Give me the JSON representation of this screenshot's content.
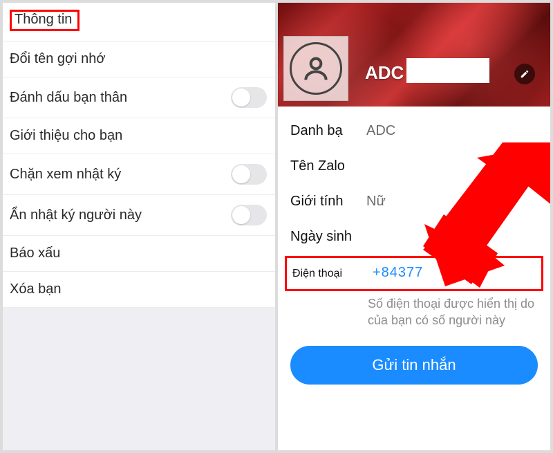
{
  "left": {
    "title": "Thông tin",
    "items": [
      {
        "label": "Đổi tên gợi nhớ",
        "toggle": false
      },
      {
        "label": "Đánh dấu bạn thân",
        "toggle": true
      },
      {
        "label": "Giới thiệu cho bạn",
        "toggle": false
      },
      {
        "label": "Chặn xem nhật ký",
        "toggle": true
      },
      {
        "label": "Ẩn nhật ký người này",
        "toggle": true
      },
      {
        "label": "Báo xấu",
        "toggle": false
      },
      {
        "label": "Xóa bạn",
        "toggle": false
      }
    ]
  },
  "right": {
    "name": "ADC",
    "fields": {
      "contact_label": "Danh bạ",
      "contact_value": "ADC",
      "zalo_label": "Tên Zalo",
      "gender_label": "Giới tính",
      "gender_value": "Nữ",
      "dob_label": "Ngày sinh",
      "phone_label": "Điện thoại",
      "phone_value": "+84377"
    },
    "helper_line1": "Số điện thoại được hiển thị do",
    "helper_line2": "của bạn có số người này",
    "send_label": "Gửi tin nhắn"
  }
}
